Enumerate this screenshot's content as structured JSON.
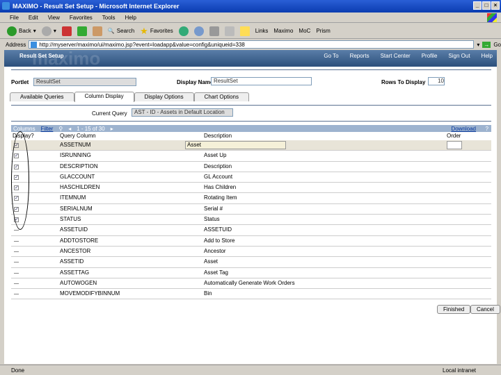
{
  "window": {
    "title": "MAXIMO - Result Set Setup - Microsoft Internet Explorer"
  },
  "menu": [
    "File",
    "Edit",
    "View",
    "Favorites",
    "Tools",
    "Help"
  ],
  "toolbar": {
    "back": "Back",
    "search": "Search",
    "favorites": "Favorites",
    "links": "Links",
    "link_items": [
      "Maximo",
      "MoC",
      "Prism"
    ]
  },
  "address": {
    "label": "Address",
    "url": "http://myserver/maximo/ui/maximo.jsp?event=loadapp&value=config&uniqueid=338",
    "go": "Go"
  },
  "header": {
    "brand": "maximo",
    "title": "Result Set Setup",
    "nav": [
      "Go To",
      "Reports",
      "Start Center",
      "Profile",
      "Sign Out",
      "Help"
    ]
  },
  "form": {
    "portlet_label": "Portlet",
    "portlet_value": "ResultSet",
    "display_name_label": "Display Name",
    "display_name_value": "ResultSet",
    "rows_label": "Rows To Display",
    "rows_value": "10"
  },
  "tabs": [
    "Available Queries",
    "Column Display",
    "Display Options",
    "Chart Options"
  ],
  "query": {
    "label": "Current Query",
    "value": "AST - ID - Assets in Default Location"
  },
  "table": {
    "title": "Columns",
    "filter": "Filter",
    "paging": "1 - 15 of 30",
    "download": "Download",
    "headers": [
      "Display?",
      "Query Column",
      "Description",
      "Order"
    ],
    "rows": [
      {
        "col": "ASSETNUM",
        "desc": "Asset",
        "checked": true
      },
      {
        "col": "ISRUNNING",
        "desc": "Asset Up",
        "checked": true
      },
      {
        "col": "DESCRIPTION",
        "desc": "Description",
        "checked": true
      },
      {
        "col": "GLACCOUNT",
        "desc": "GL Account",
        "checked": true
      },
      {
        "col": "HASCHILDREN",
        "desc": "Has Children",
        "checked": true
      },
      {
        "col": "ITEMNUM",
        "desc": "Rotating Item",
        "checked": true
      },
      {
        "col": "SERIALNUM",
        "desc": "Serial #",
        "checked": true
      },
      {
        "col": "STATUS",
        "desc": "Status",
        "checked": true
      },
      {
        "col": "ASSETUID",
        "desc": "ASSETUID",
        "checked": false
      },
      {
        "col": "ADDTOSTORE",
        "desc": "Add to Store",
        "checked": false
      },
      {
        "col": "ANCESTOR",
        "desc": "Ancestor",
        "checked": false
      },
      {
        "col": "ASSETID",
        "desc": "Asset",
        "checked": false
      },
      {
        "col": "ASSETTAG",
        "desc": "Asset Tag",
        "checked": false
      },
      {
        "col": "AUTOWOGEN",
        "desc": "Automatically Generate Work Orders",
        "checked": false
      },
      {
        "col": "MOVEMODIFYBINNUM",
        "desc": "Bin",
        "checked": false
      }
    ]
  },
  "buttons": {
    "finished": "Finished",
    "cancel": "Cancel"
  },
  "statusbar": {
    "text": "Done",
    "zone": "Local intranet"
  }
}
